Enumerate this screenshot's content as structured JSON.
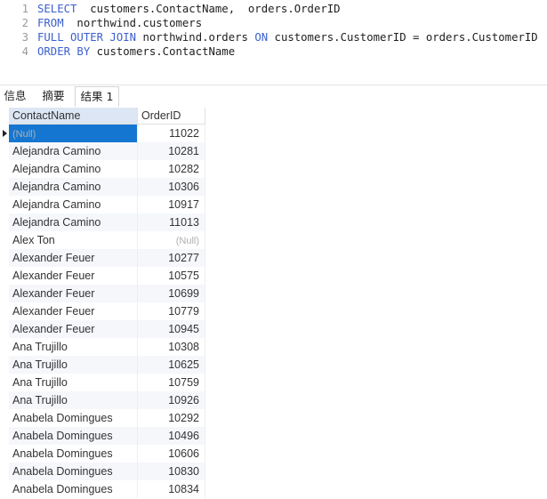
{
  "editor": {
    "lines": [
      {
        "n": "1",
        "parts": [
          {
            "t": "kw",
            "v": "SELECT"
          },
          {
            "t": "tx",
            "v": "  customers.ContactName,  orders.OrderID"
          }
        ]
      },
      {
        "n": "2",
        "parts": [
          {
            "t": "kw",
            "v": "FROM"
          },
          {
            "t": "tx",
            "v": "  northwind.customers"
          }
        ]
      },
      {
        "n": "3",
        "parts": [
          {
            "t": "kw",
            "v": "FULL OUTER JOIN"
          },
          {
            "t": "tx",
            "v": " northwind.orders "
          },
          {
            "t": "kw",
            "v": "ON"
          },
          {
            "t": "tx",
            "v": " customers.CustomerID = orders.CustomerID"
          }
        ]
      },
      {
        "n": "4",
        "parts": [
          {
            "t": "kw",
            "v": "ORDER BY"
          },
          {
            "t": "tx",
            "v": " customers.ContactName"
          }
        ]
      }
    ]
  },
  "tabs": [
    "信息",
    "摘要",
    "结果 1"
  ],
  "active_tab": 2,
  "grid": {
    "columns": [
      "ContactName",
      "OrderID"
    ],
    "null_text": "(Null)",
    "rows": [
      [
        null,
        "11022"
      ],
      [
        "Alejandra Camino",
        "10281"
      ],
      [
        "Alejandra Camino",
        "10282"
      ],
      [
        "Alejandra Camino",
        "10306"
      ],
      [
        "Alejandra Camino",
        "10917"
      ],
      [
        "Alejandra Camino",
        "11013"
      ],
      [
        "Alex Ton",
        null
      ],
      [
        "Alexander Feuer",
        "10277"
      ],
      [
        "Alexander Feuer",
        "10575"
      ],
      [
        "Alexander Feuer",
        "10699"
      ],
      [
        "Alexander Feuer",
        "10779"
      ],
      [
        "Alexander Feuer",
        "10945"
      ],
      [
        "Ana Trujillo",
        "10308"
      ],
      [
        "Ana Trujillo",
        "10625"
      ],
      [
        "Ana Trujillo",
        "10759"
      ],
      [
        "Ana Trujillo",
        "10926"
      ],
      [
        "Anabela Domingues",
        "10292"
      ],
      [
        "Anabela Domingues",
        "10496"
      ],
      [
        "Anabela Domingues",
        "10606"
      ],
      [
        "Anabela Domingues",
        "10830"
      ],
      [
        "Anabela Domingues",
        "10834"
      ]
    ],
    "selected_row": 0
  }
}
